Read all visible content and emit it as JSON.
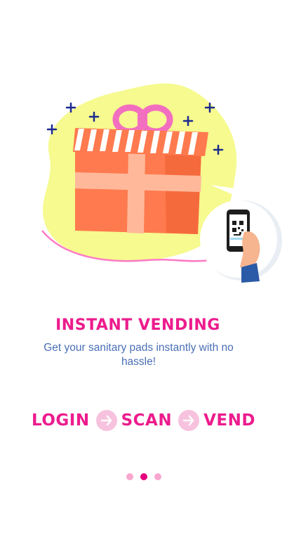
{
  "onboarding": {
    "title": "INSTANT VENDING",
    "subtitle": "Get your sanitary pads instantly with no hassle!",
    "steps": [
      {
        "label": "LOGIN"
      },
      {
        "label": "SCAN"
      },
      {
        "label": "VEND"
      }
    ],
    "pager": {
      "total": 3,
      "active_index": 1
    }
  },
  "colors": {
    "accent": "#ec1c8d",
    "subtitle": "#4a6fb5",
    "blob": "#f6fa8f",
    "gift": "#ff7a4f",
    "dot_inactive": "#f9a6cf",
    "dot_active": "#e5007e"
  },
  "icons": {
    "arrow": "arrow-right-icon",
    "illustration": "gift-box-with-qr-phone"
  }
}
